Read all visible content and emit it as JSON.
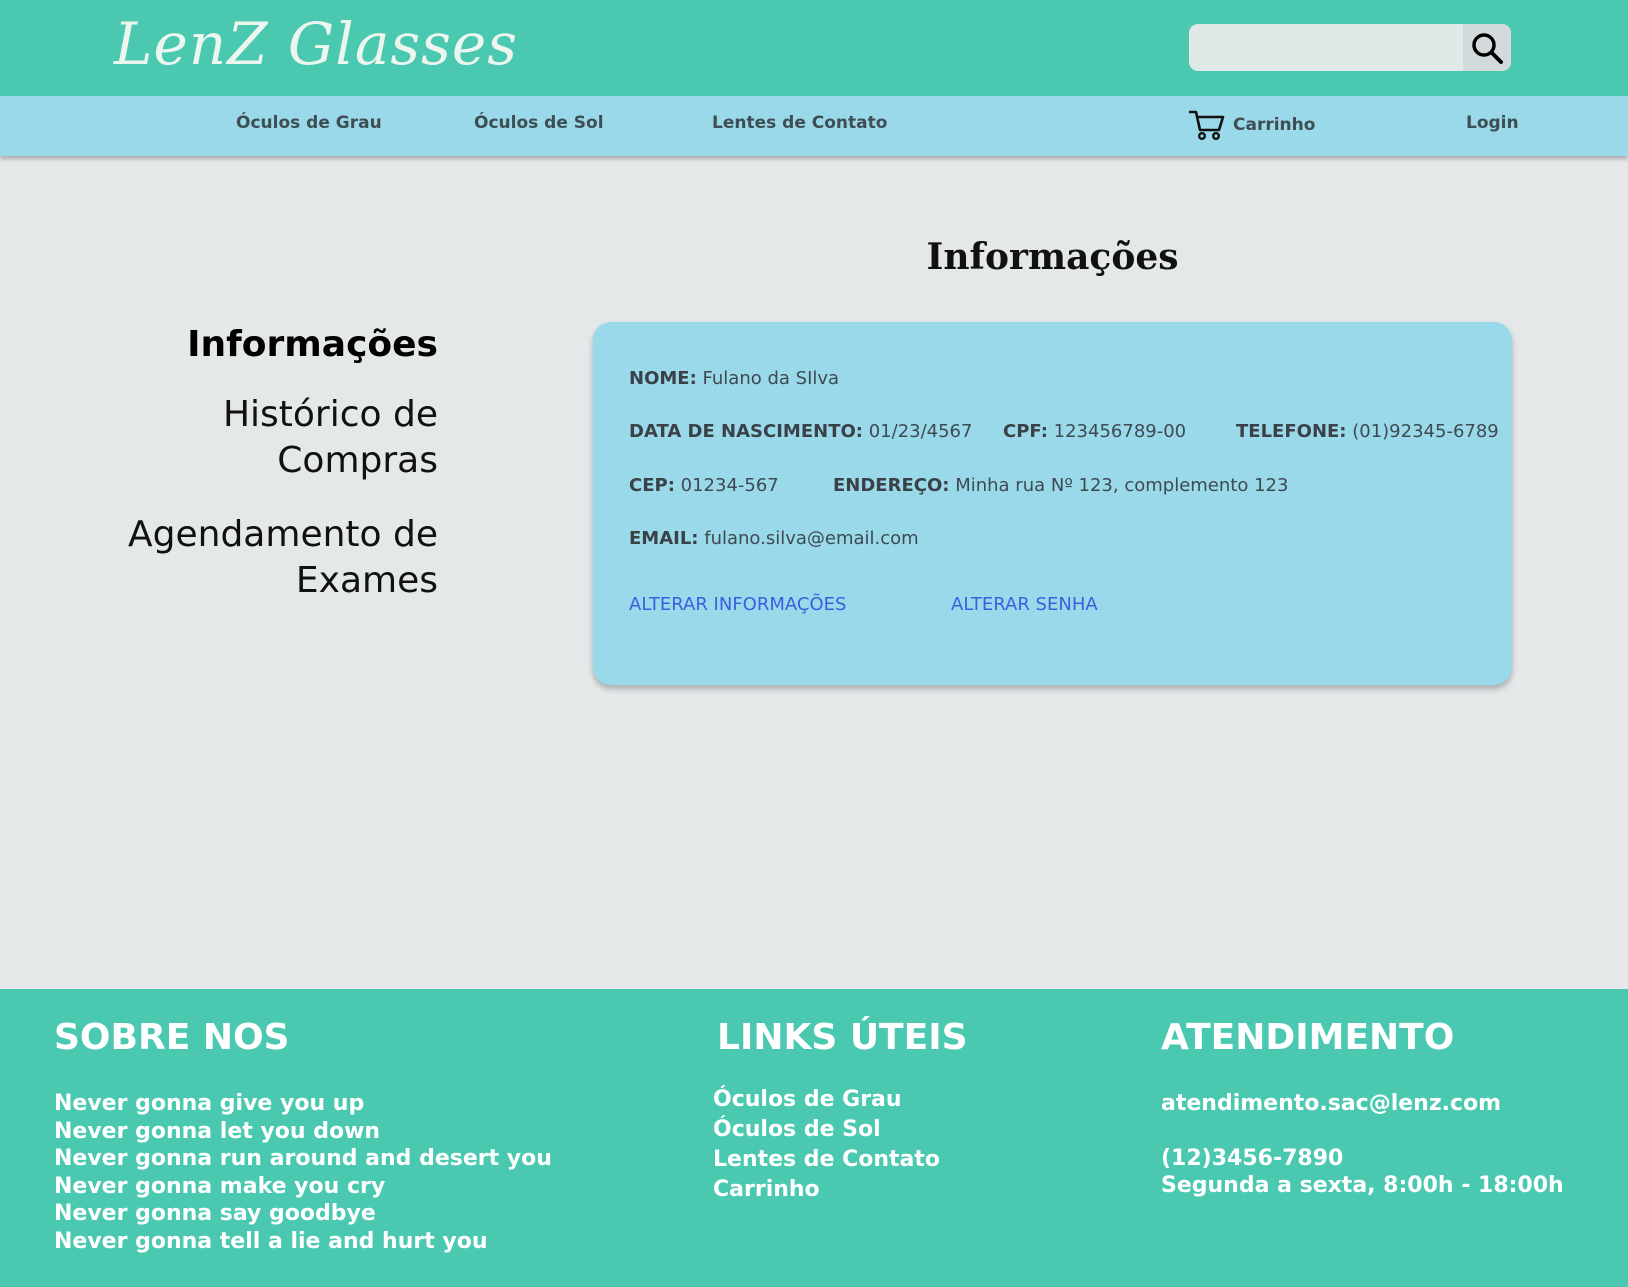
{
  "header": {
    "logo": "LenZ Glasses",
    "search": {
      "placeholder": "",
      "value": ""
    }
  },
  "nav": {
    "items": [
      {
        "label": "Óculos de Grau"
      },
      {
        "label": "Óculos de Sol"
      },
      {
        "label": "Lentes de Contato"
      }
    ],
    "cart_label": "Carrinho",
    "login_label": "Login"
  },
  "sidebar": {
    "items": [
      {
        "label": "Informações",
        "active": true
      },
      {
        "label": "Histórico de Compras"
      },
      {
        "label": "Agendamento de Exames"
      }
    ]
  },
  "main": {
    "title": "Informações",
    "fields": {
      "nome": {
        "label": "NOME:",
        "value": "Fulano da SIlva"
      },
      "nascimento": {
        "label": "DATA DE NASCIMENTO:",
        "value": "01/23/4567"
      },
      "cpf": {
        "label": "CPF:",
        "value": "123456789-00"
      },
      "telefone": {
        "label": "TELEFONE:",
        "value": "(01)92345-6789"
      },
      "cep": {
        "label": "CEP:",
        "value": "01234-567"
      },
      "endereco": {
        "label": "ENDEREÇO:",
        "value": "Minha rua Nº 123, complemento 123"
      },
      "email": {
        "label": "EMAIL:",
        "value": "fulano.silva@email.com"
      }
    },
    "actions": {
      "alterar_info": "ALTERAR INFORMAÇÕES",
      "alterar_senha": "ALTERAR SENHA"
    }
  },
  "footer": {
    "sobre": {
      "title": "SOBRE NOS",
      "lines": [
        "Never gonna give you up",
        "Never gonna let you down",
        "Never gonna run around and desert you",
        "Never gonna make you cry",
        "Never gonna say goodbye",
        "Never gonna tell a lie and hurt you"
      ]
    },
    "links": {
      "title": "LINKS ÚTEIS",
      "items": [
        "Óculos de Grau",
        "Óculos de Sol",
        "Lentes de Contato",
        "Carrinho"
      ]
    },
    "atendimento": {
      "title": "ATENDIMENTO",
      "email": "atendimento.sac@lenz.com",
      "phone": "(12)3456-7890",
      "hours": "Segunda a sexta, 8:00h - 18:00h"
    }
  },
  "colors": {
    "header_bg": "#4ac9b0",
    "nav_bg": "#9ad9e9",
    "page_bg": "#e4e8e9",
    "card_bg": "#9ad9e9",
    "link": "#3a5ee0"
  }
}
